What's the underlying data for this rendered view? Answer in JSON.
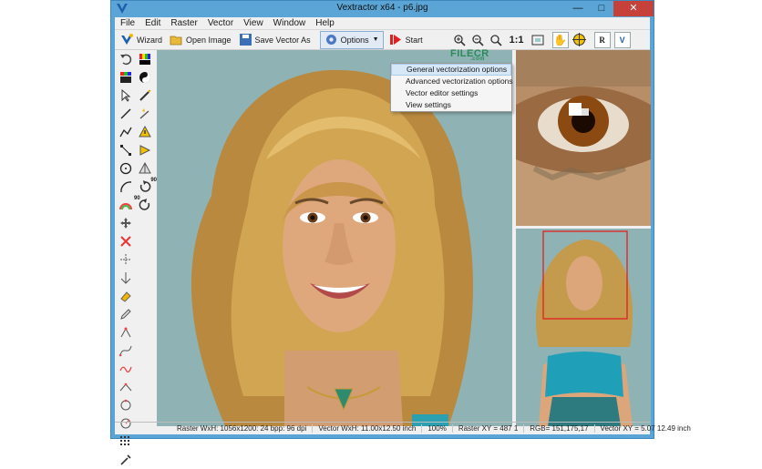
{
  "window": {
    "title": "Vextractor x64 - p6.jpg"
  },
  "menu": [
    "File",
    "Edit",
    "Raster",
    "Vector",
    "View",
    "Window",
    "Help"
  ],
  "toolbar": {
    "wizard": "Wizard",
    "open_image": "Open Image",
    "save_vector": "Save Vector As",
    "options": "Options",
    "start": "Start",
    "zoom_fit": "1:1"
  },
  "options_menu": {
    "items": [
      "General vectorization options",
      "Advanced vectorization options",
      "Vector editor settings",
      "View settings"
    ]
  },
  "watermark": {
    "text": "FILECR",
    "sub": ".com"
  },
  "statusbar": {
    "raster": "Raster WxH: 1056x1200: 24 bpp: 96 dpi",
    "vector": "Vector WxH: 11.00x12.50 inch",
    "zoom": "100%",
    "raster_xy": "Raster XY =  487    1",
    "rgb": "RGB= 151,175,17",
    "vector_xy": "Vector XY =  5.07 12.49 inch"
  },
  "left_tool_labels": {
    "rotate_cw": "90",
    "rotate_ccw": "90"
  },
  "colors": {
    "canvas_bg": "#8fb3b4",
    "hair": "#c89a45",
    "skin": "#dca67a",
    "accent_red": "#e02020"
  }
}
